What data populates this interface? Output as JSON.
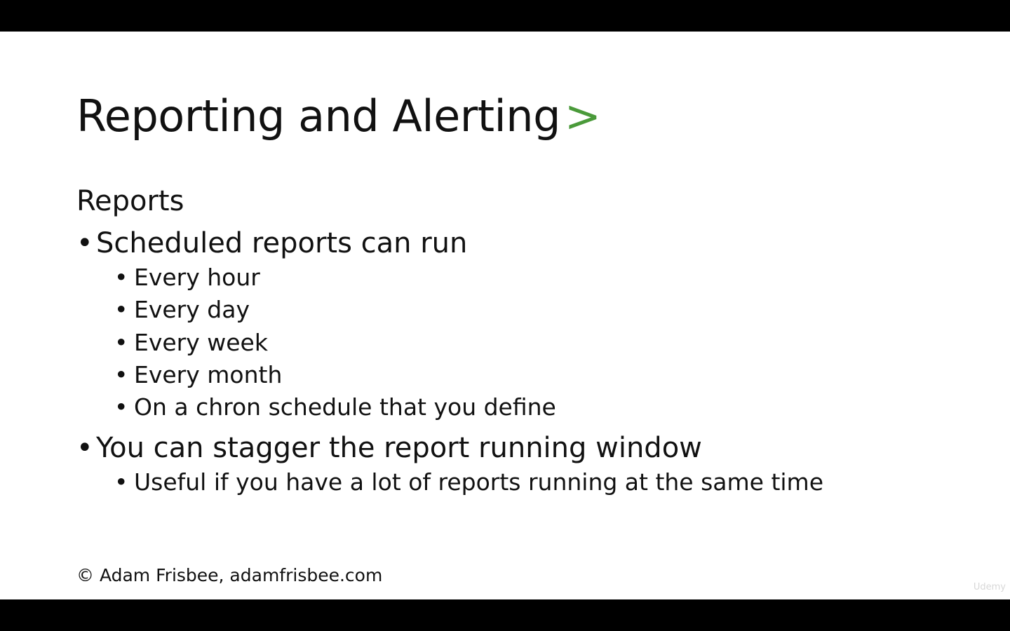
{
  "slide": {
    "title": "Reporting and Alerting",
    "title_glyph": ">",
    "accent_color": "#4a9a3a",
    "section_heading": "Reports",
    "bullets": [
      {
        "text": "Scheduled reports can run",
        "children": [
          "Every hour",
          "Every day",
          "Every week",
          "Every month",
          "On a chron schedule that you define"
        ]
      },
      {
        "text": "You can stagger the report running window",
        "children": [
          "Useful if you have a lot of reports running at the same time"
        ]
      }
    ],
    "bullet_glyph": "•",
    "footer": "© Adam Frisbee, adamfrisbee.com",
    "watermark": "Udemy"
  }
}
